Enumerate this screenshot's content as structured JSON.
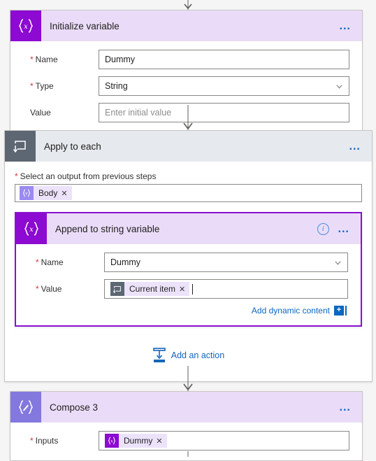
{
  "flow": {
    "steps": [
      {
        "id": "initialize-variable",
        "title": "Initialize variable",
        "icon": "variable-braces-x-icon",
        "menu": "…",
        "fields": [
          {
            "label": "Name",
            "required": true,
            "value": "Dummy",
            "placeholder": "",
            "type": "text"
          },
          {
            "label": "Type",
            "required": true,
            "value": "String",
            "placeholder": "",
            "type": "select"
          },
          {
            "label": "Value",
            "required": false,
            "value": "",
            "placeholder": "Enter initial value",
            "type": "text"
          }
        ]
      },
      {
        "id": "apply-to-each",
        "title": "Apply to each",
        "icon": "loop-repeat-icon",
        "menu": "…",
        "picker_label": "Select an output from previous steps",
        "picker_required": true,
        "picker_token": {
          "label": "Body",
          "icon": "variable-braces-v-icon",
          "remove": "✕"
        },
        "add_action_label": "Add an action",
        "add_action_icon": "insert-action-icon",
        "inner": {
          "id": "append-to-string-variable",
          "title": "Append to string variable",
          "icon": "variable-braces-x-icon",
          "info": "i",
          "menu": "…",
          "selected": true,
          "fields": [
            {
              "label": "Name",
              "required": true,
              "value": "Dummy",
              "placeholder": "",
              "type": "select"
            },
            {
              "label": "Value",
              "required": true,
              "value": "",
              "placeholder": "",
              "type": "token",
              "token": {
                "label": "Current item",
                "icon": "loop-repeat-icon",
                "remove": "✕"
              }
            }
          ],
          "dynamic_content_label": "Add dynamic content",
          "dynamic_content_plus": "+"
        }
      },
      {
        "id": "compose-3",
        "title": "Compose 3",
        "icon": "compose-pencil-icon",
        "menu": "…",
        "fields": [
          {
            "label": "Inputs",
            "required": true,
            "value": "",
            "placeholder": "",
            "type": "token",
            "token": {
              "label": "Dummy",
              "icon": "variable-braces-x-icon",
              "remove": "✕"
            }
          }
        ]
      }
    ]
  },
  "colors": {
    "variable_icon": "#8c0ad1",
    "compose_icon": "#8378de",
    "loop_icon": "#5d6673",
    "header_purple": "#eadcf8",
    "header_gray": "#e6eaee",
    "selected_border": "#8a0fd1",
    "link_blue": "#0b67c2",
    "required_red": "#d13438",
    "canvas": "#f5f5f5"
  }
}
